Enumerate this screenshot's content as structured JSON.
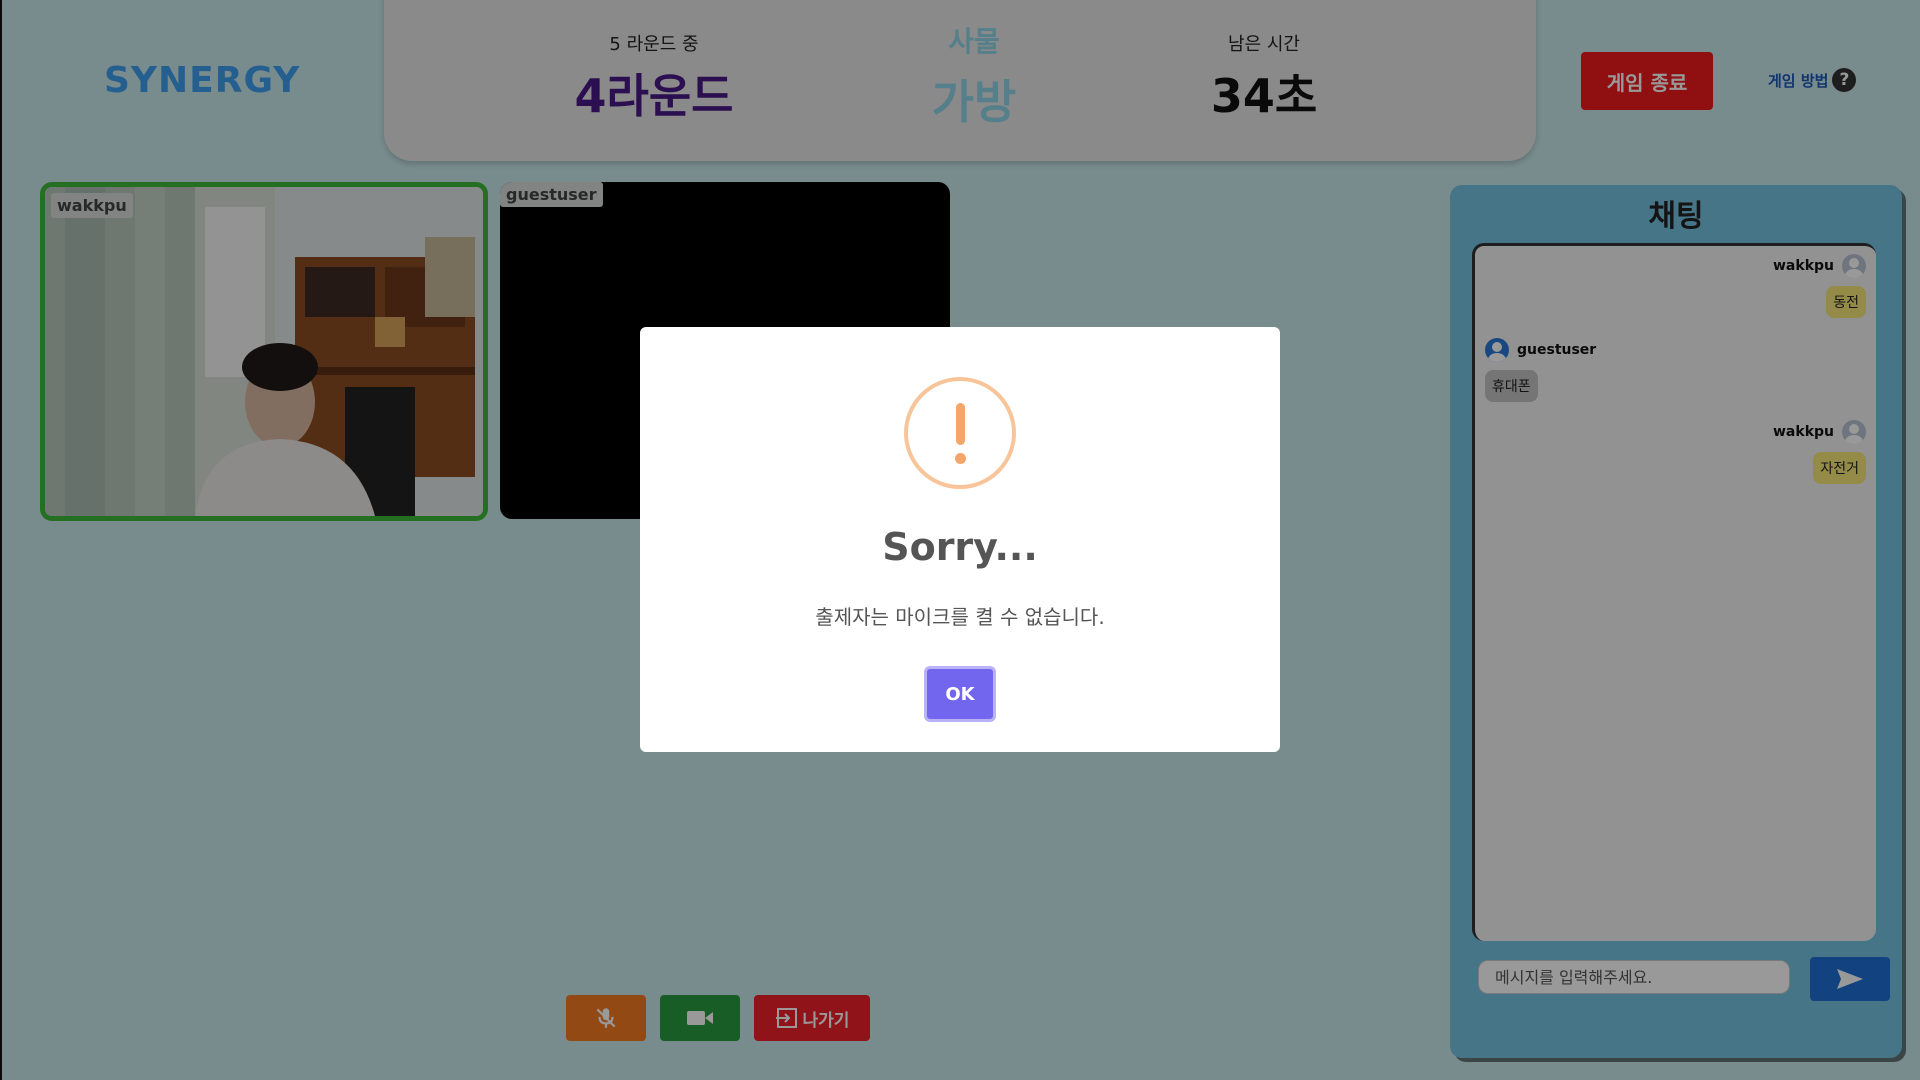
{
  "header": {
    "logo": "SYNERGY",
    "round_caption": "5 라운드 중",
    "round_value": "4라운드",
    "category_label": "사물",
    "category_word": "가방",
    "time_caption": "남은 시간",
    "time_value": "34초",
    "end_game_label": "게임 종료",
    "how_to_label": "게임 방법",
    "help_icon": "?"
  },
  "videos": [
    {
      "name": "wakkpu"
    },
    {
      "name": "guestuser"
    }
  ],
  "controls": {
    "mic_icon": "mic-off-icon",
    "camera_icon": "video-camera-icon",
    "leave_label": "나가기"
  },
  "chat": {
    "title": "채팅",
    "messages": [
      {
        "user": "wakkpu",
        "text": "동전",
        "side": "right"
      },
      {
        "user": "guestuser",
        "text": "휴대폰",
        "side": "left"
      },
      {
        "user": "wakkpu",
        "text": "자전거",
        "side": "right"
      }
    ],
    "input_placeholder": "메시지를 입력해주세요."
  },
  "modal": {
    "title": "Sorry...",
    "message": "출제자는 마이크를 켤 수 없습니다.",
    "ok_label": "OK"
  },
  "colors": {
    "background": "#c8e9eb",
    "accent_purple": "#4a1a86",
    "end_button": "#f01b1e",
    "chat_panel": "#75c3e1",
    "ok_button": "#7366ee"
  }
}
